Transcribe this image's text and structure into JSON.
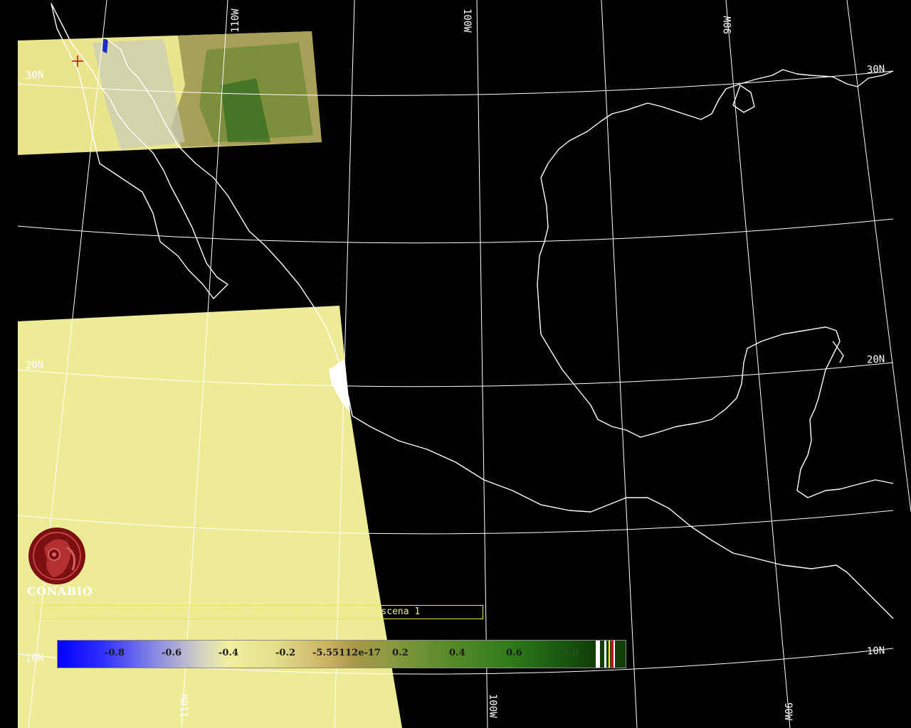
{
  "title": "CONABIO",
  "status_line": "aqua-1 modis 2006/09/15 21:03:27 091. Puntos de calor en la escena 1",
  "grid_labels": {
    "lon_110_top": "110W",
    "lon_100_top": "100W",
    "lon_90_top": "90W",
    "lon_110_bottom": "110W",
    "lon_100_bottom": "100W",
    "lon_90_bottom": "90W",
    "lat_30_left": "30N",
    "lat_30_right": "30N",
    "lat_20_left": "20N",
    "lat_20_right": "20N",
    "lat_10_left": "10N",
    "lat_10_right": "10N"
  },
  "colorbar": {
    "ticks": [
      "-0.8",
      "-0.6",
      "-0.4",
      "-0.2",
      "-5.55112e-17",
      "0.2",
      "0.4",
      "0.6",
      "0.8"
    ]
  },
  "colors": {
    "background": "#000000",
    "grid": "#ffffff",
    "coastline": "#ffffff",
    "scene_fill": "#eeeb96",
    "logo": "#7a1010",
    "status_border": "#e8e850",
    "hotspot_marker": "#cc0000"
  },
  "icons": {
    "logo": "conabio-macaw-logo",
    "hotspot": "red-cross-marker"
  }
}
